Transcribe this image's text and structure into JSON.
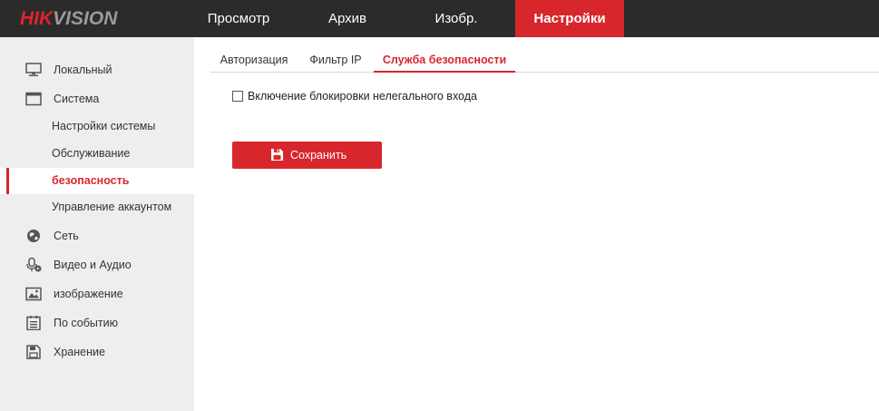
{
  "brand": {
    "logo_part1": "HIK",
    "logo_part2": "VISION"
  },
  "topnav": {
    "items": [
      {
        "label": "Просмотр",
        "active": false
      },
      {
        "label": "Архив",
        "active": false
      },
      {
        "label": "Изобр.",
        "active": false
      },
      {
        "label": "Настройки",
        "active": true
      }
    ]
  },
  "sidebar": {
    "items": [
      {
        "label": "Локальный",
        "icon": "monitor-icon"
      },
      {
        "label": "Система",
        "icon": "system-window-icon"
      },
      {
        "label": "Настройки системы",
        "sub": true
      },
      {
        "label": "Обслуживание",
        "sub": true
      },
      {
        "label": "безопасность",
        "sub": true,
        "active": true
      },
      {
        "label": "Управление аккаунтом",
        "sub": true
      },
      {
        "label": "Сеть",
        "icon": "globe-icon"
      },
      {
        "label": "Видео и Аудио",
        "icon": "microphone-video-icon"
      },
      {
        "label": "изображение",
        "icon": "image-icon"
      },
      {
        "label": "По событию",
        "icon": "event-list-icon"
      },
      {
        "label": "Хранение",
        "icon": "storage-disk-icon"
      }
    ]
  },
  "tabs": [
    {
      "label": "Авторизация",
      "active": false
    },
    {
      "label": "Фильтр IP",
      "active": false
    },
    {
      "label": "Служба безопасности",
      "active": true
    }
  ],
  "security": {
    "illegal_login_lock_label": "Включение блокировки нелегального входа",
    "illegal_login_lock_checked": false
  },
  "save_button": {
    "label": "Сохранить",
    "icon": "floppy-disk-icon"
  },
  "colors": {
    "accent": "#d8262d",
    "topbar": "#2b2b2b",
    "sidebar": "#eeeeee"
  }
}
